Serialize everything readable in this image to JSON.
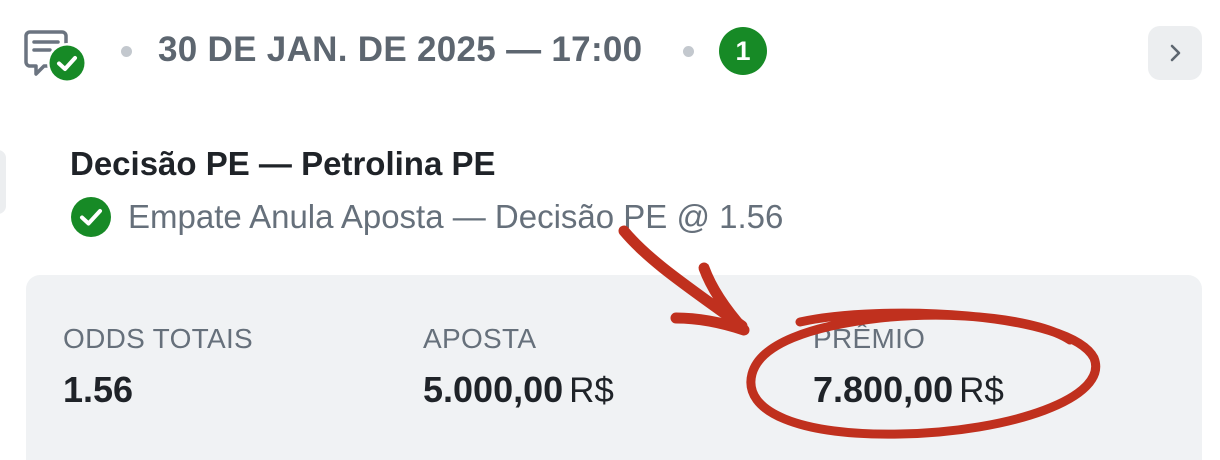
{
  "header": {
    "date_time": "30 DE JAN. DE 2025 — 17:00",
    "count": "1",
    "status_color": "#178a26",
    "ticket_icon": "ticket-check-icon",
    "nav_icon": "chevron-right-icon"
  },
  "bet": {
    "match": "Decisão PE — Petrolina PE",
    "selection": "Empate Anula Aposta — Decisão PE @ 1.56",
    "selection_icon": "check-circle-icon"
  },
  "summary": {
    "odds_label": "ODDS TOTAIS",
    "odds_value": "1.56",
    "stake_label": "APOSTA",
    "stake_value": "5.000,00",
    "stake_currency": "R$",
    "prize_label": "PRÊMIO",
    "prize_value": "7.800,00",
    "prize_currency": "R$"
  },
  "annotation": {
    "color": "#c0301e",
    "shapes": [
      "arrow",
      "ellipse"
    ]
  }
}
